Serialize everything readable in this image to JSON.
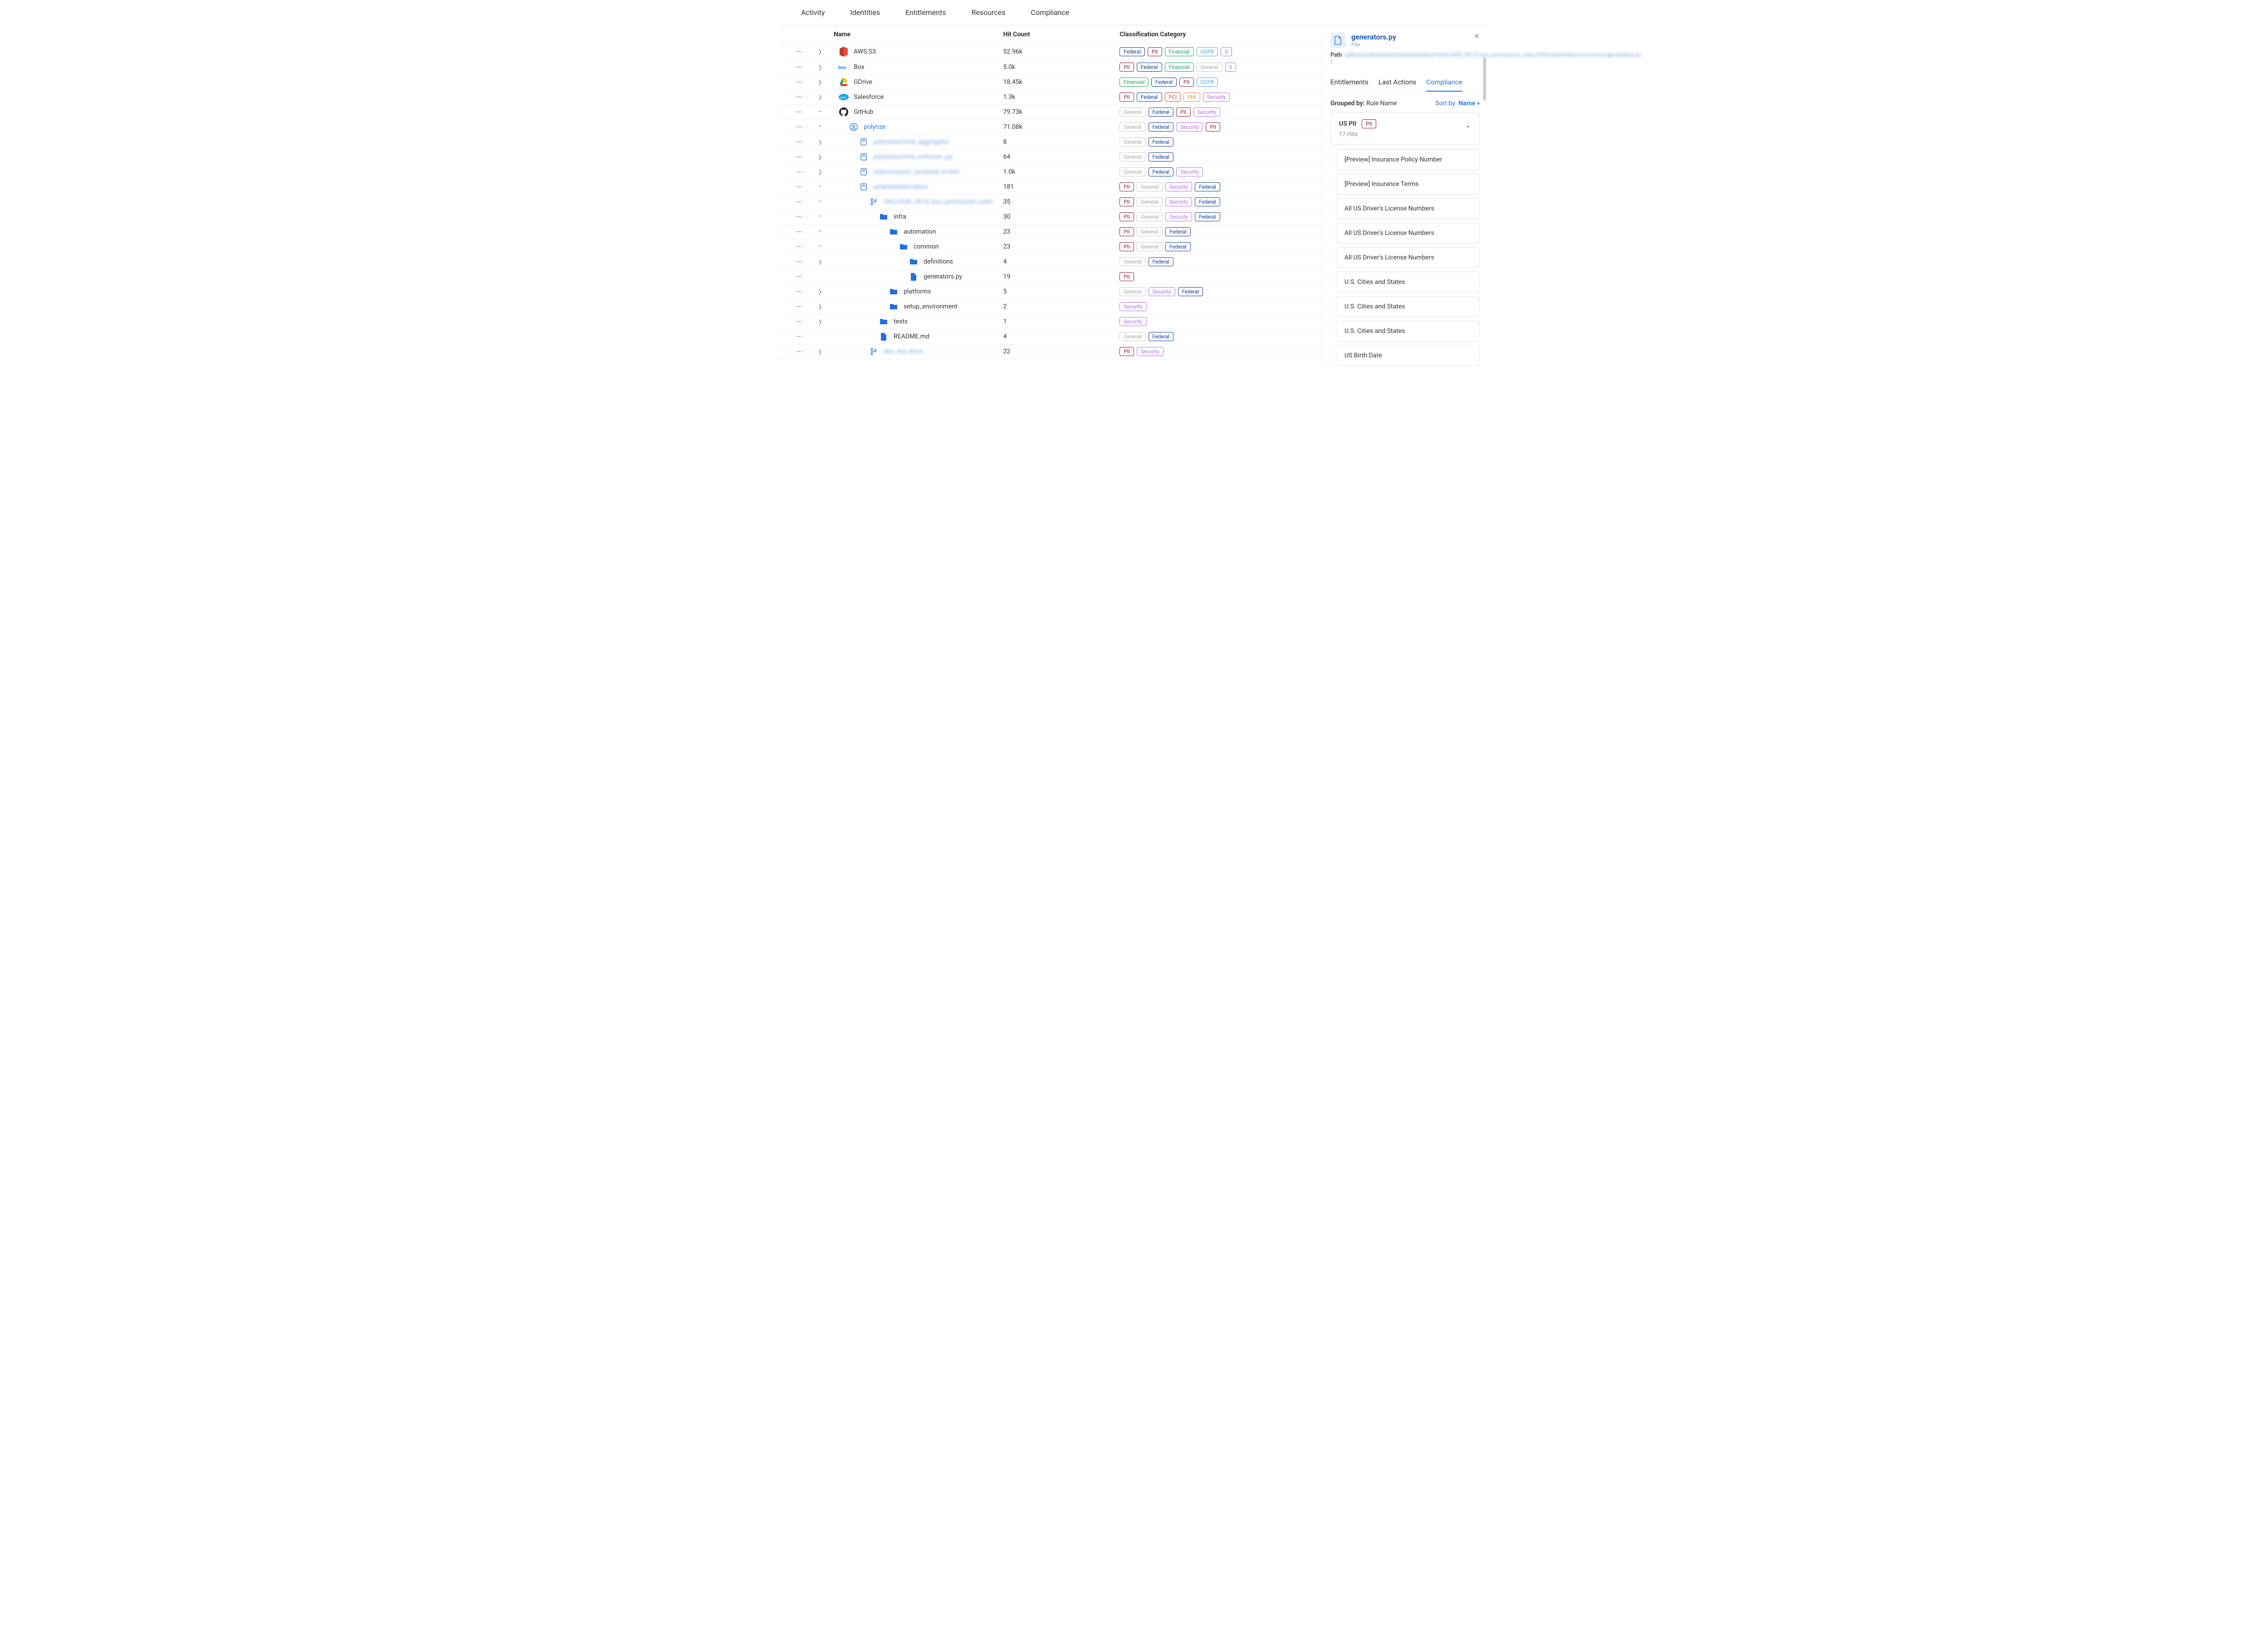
{
  "nav": {
    "items": [
      "Activity",
      "Identities",
      "Entitlements",
      "Resources",
      "Compliance"
    ]
  },
  "table": {
    "headers": {
      "name": "Name",
      "hit": "Hit Count",
      "cat": "Classification Category"
    }
  },
  "tag_labels": {
    "federal": "Federal",
    "pii": "PII",
    "financial": "Financial",
    "gdpr": "GDPR",
    "security": "Security",
    "general": "General",
    "pci": "PCI",
    "phi": "PHI",
    "s": "S"
  },
  "rows": [
    {
      "id": "aws-s3",
      "depth": 0,
      "icon": "s3",
      "label": "AWS S3",
      "hit": "52.96k",
      "exp": "right",
      "tags": [
        "federal",
        "pii",
        "financial",
        "gdpr",
        "s"
      ]
    },
    {
      "id": "box",
      "depth": 0,
      "icon": "box",
      "label": "Box",
      "hit": "5.0k",
      "exp": "right",
      "tags": [
        "pii",
        "federal",
        "financial",
        "general",
        "s"
      ]
    },
    {
      "id": "gdrive",
      "depth": 0,
      "icon": "gdrive",
      "label": "GDrive",
      "hit": "18.45k",
      "exp": "right",
      "tags": [
        "financial",
        "federal",
        "pii",
        "gdpr"
      ]
    },
    {
      "id": "salesforce",
      "depth": 0,
      "icon": "sf",
      "label": "Salesforce",
      "hit": "1.3k",
      "exp": "right",
      "tags": [
        "pii",
        "federal",
        "pci",
        "phi",
        "security"
      ]
    },
    {
      "id": "github",
      "depth": 0,
      "icon": "gh",
      "label": "GitHub",
      "hit": "79.73k",
      "exp": "down",
      "tags": [
        "general",
        "federal",
        "pii",
        "security"
      ]
    },
    {
      "id": "polyrize",
      "depth": 1,
      "icon": "person",
      "label": "polyrize",
      "link": true,
      "hit": "71.08k",
      "exp": "down",
      "tags": [
        "general",
        "federal",
        "security",
        "pii"
      ]
    },
    {
      "id": "repo1",
      "depth": 2,
      "icon": "repo",
      "label": "polyrizeactivity_aggregator",
      "blur": true,
      "hit": "8",
      "exp": "right",
      "tags": [
        "general",
        "federal"
      ]
    },
    {
      "id": "repo2",
      "depth": 2,
      "icon": "repo",
      "label": "polyrizeactivity_enforcer_ag",
      "blur": true,
      "hit": "64",
      "exp": "right",
      "tags": [
        "general",
        "federal"
      ]
    },
    {
      "id": "repo3",
      "depth": 2,
      "icon": "repo",
      "label": "polyrizeasync_backend_broker",
      "blur": true,
      "hit": "1.0k",
      "exp": "right",
      "tags": [
        "general",
        "federal",
        "security"
      ]
    },
    {
      "id": "repo4",
      "depth": 2,
      "icon": "repo",
      "label": "polyrizeautomation",
      "blur": true,
      "hit": "181",
      "exp": "down",
      "tags": [
        "pii",
        "general",
        "security",
        "federal"
      ]
    },
    {
      "id": "branch",
      "depth": 3,
      "icon": "branch",
      "label": "SACLOUD_3014_box_permission_rules",
      "blur": true,
      "hit": "35",
      "exp": "down",
      "tags": [
        "pii",
        "general",
        "security",
        "federal"
      ]
    },
    {
      "id": "infra",
      "depth": 4,
      "icon": "folder",
      "label": "infra",
      "hit": "30",
      "exp": "down",
      "tags": [
        "pii",
        "general",
        "security",
        "federal"
      ]
    },
    {
      "id": "automation",
      "depth": 5,
      "icon": "folder",
      "label": "automation",
      "hit": "23",
      "exp": "down",
      "tags": [
        "pii",
        "general",
        "federal"
      ]
    },
    {
      "id": "common",
      "depth": 6,
      "icon": "folder",
      "label": "common",
      "hit": "23",
      "exp": "down",
      "tags": [
        "pii",
        "general",
        "federal"
      ]
    },
    {
      "id": "definitions",
      "depth": 7,
      "icon": "folder",
      "label": "definitions",
      "hit": "4",
      "exp": "right",
      "tags": [
        "general",
        "federal"
      ]
    },
    {
      "id": "generators",
      "depth": 7,
      "icon": "file",
      "label": "generators.py",
      "hit": "19",
      "exp": "none",
      "tags": [
        "pii"
      ]
    },
    {
      "id": "platforms",
      "depth": 5,
      "icon": "folder",
      "label": "platforms",
      "hit": "5",
      "exp": "right",
      "tags": [
        "general",
        "security",
        "federal"
      ]
    },
    {
      "id": "setup_env",
      "depth": 5,
      "icon": "folder",
      "label": "setup_environment",
      "hit": "2",
      "exp": "right",
      "tags": [
        "security"
      ]
    },
    {
      "id": "tests",
      "depth": 4,
      "icon": "folder",
      "label": "tests",
      "hit": "1",
      "exp": "right",
      "tags": [
        "security"
      ]
    },
    {
      "id": "readme",
      "depth": 4,
      "icon": "file",
      "label": "README.md",
      "hit": "4",
      "exp": "none",
      "tags": [
        "general",
        "federal"
      ]
    },
    {
      "id": "branch2",
      "depth": 3,
      "icon": "branch",
      "label": "doc_the_docs",
      "blur": true,
      "hit": "22",
      "exp": "right",
      "tags": [
        "pii",
        "security"
      ]
    }
  ],
  "sidepanel": {
    "title": "generators.py",
    "subtitle": "File",
    "path_label": "Path :",
    "path_value": "/github/polyrize/polyrizeautomation/SACLOUD_3014_box_permission_rules/infra/automation/common/generators.py",
    "tabs": [
      "Entitlements",
      "Last Actions",
      "Compliance"
    ],
    "active_tab": "Compliance",
    "grouped_by_label": "Grouped by:",
    "grouped_by_value": "Rule Name",
    "sort_by_label": "Sort by:",
    "sort_by_value": "Name",
    "group": {
      "title": "US PII",
      "tag": "pii",
      "hits": "17 Hits"
    },
    "items": [
      "[Preview] Insurance Policy Number",
      "[Preview] Insurance Terms",
      "All US Driver's License Numbers",
      "All US Driver's License Numbers",
      "All US Driver's License Numbers",
      "U.S. Cities and States",
      "U.S. Cities and States",
      "U.S. Cities and States",
      "US Birth Date"
    ]
  }
}
